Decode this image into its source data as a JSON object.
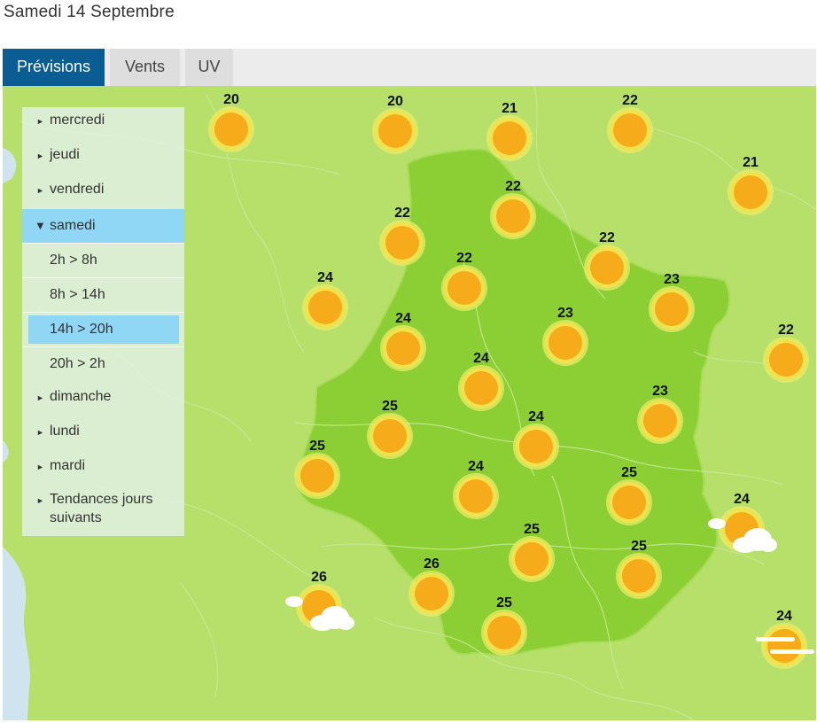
{
  "header": {
    "date": "Samedi 14 Septembre"
  },
  "tabs": [
    {
      "label": "Prévisions",
      "active": true
    },
    {
      "label": "Vents",
      "active": false
    },
    {
      "label": "UV",
      "active": false
    }
  ],
  "menu": {
    "days_before": [
      "mercredi",
      "jeudi",
      "vendredi"
    ],
    "selected_day": "samedi",
    "periods": [
      "2h > 8h",
      "8h > 14h",
      "14h > 20h",
      "20h > 2h"
    ],
    "selected_period": "14h > 20h",
    "days_after": [
      "dimanche",
      "lundi",
      "mardi"
    ],
    "trends_line1": "Tendances jours",
    "trends_line2": "suivants"
  },
  "colors": {
    "tab_active": "#0a5d92",
    "menu_selected": "#8fd7f5",
    "map_outer": "#b6e06a",
    "region": "#8ccf34",
    "sun": "#f5ab1a"
  },
  "forecasts": [
    {
      "temp": "20",
      "icon": "sun-icon"
    },
    {
      "temp": "20",
      "icon": "sun-icon"
    },
    {
      "temp": "21",
      "icon": "sun-icon"
    },
    {
      "temp": "22",
      "icon": "sun-icon"
    },
    {
      "temp": "21",
      "icon": "sun-icon"
    },
    {
      "temp": "22",
      "icon": "sun-icon"
    },
    {
      "temp": "22",
      "icon": "sun-icon"
    },
    {
      "temp": "22",
      "icon": "sun-icon"
    },
    {
      "temp": "22",
      "icon": "sun-icon"
    },
    {
      "temp": "24",
      "icon": "sun-icon"
    },
    {
      "temp": "23",
      "icon": "sun-icon"
    },
    {
      "temp": "24",
      "icon": "sun-icon"
    },
    {
      "temp": "23",
      "icon": "sun-icon"
    },
    {
      "temp": "22",
      "icon": "sun-icon"
    },
    {
      "temp": "24",
      "icon": "sun-icon"
    },
    {
      "temp": "23",
      "icon": "sun-icon"
    },
    {
      "temp": "25",
      "icon": "sun-icon"
    },
    {
      "temp": "24",
      "icon": "sun-icon"
    },
    {
      "temp": "25",
      "icon": "sun-icon"
    },
    {
      "temp": "24",
      "icon": "sun-icon"
    },
    {
      "temp": "25",
      "icon": "sun-icon"
    },
    {
      "temp": "24",
      "icon": "sun-cloud-icon"
    },
    {
      "temp": "25",
      "icon": "sun-icon"
    },
    {
      "temp": "25",
      "icon": "sun-icon"
    },
    {
      "temp": "26",
      "icon": "sun-icon"
    },
    {
      "temp": "26",
      "icon": "sun-cloud-icon"
    },
    {
      "temp": "25",
      "icon": "sun-icon"
    },
    {
      "temp": "24",
      "icon": "sun-haze-icon"
    }
  ]
}
